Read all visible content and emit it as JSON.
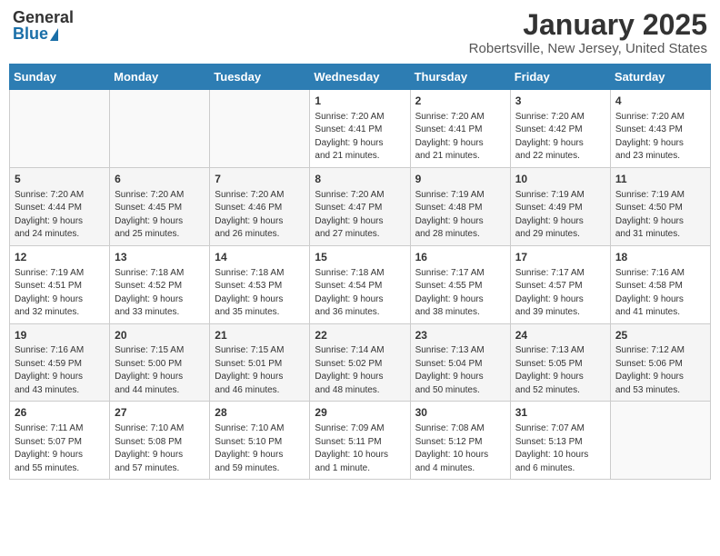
{
  "header": {
    "logo_general": "General",
    "logo_blue": "Blue",
    "title": "January 2025",
    "subtitle": "Robertsville, New Jersey, United States"
  },
  "calendar": {
    "days_of_week": [
      "Sunday",
      "Monday",
      "Tuesday",
      "Wednesday",
      "Thursday",
      "Friday",
      "Saturday"
    ],
    "weeks": [
      [
        {
          "day": "",
          "info": ""
        },
        {
          "day": "",
          "info": ""
        },
        {
          "day": "",
          "info": ""
        },
        {
          "day": "1",
          "info": "Sunrise: 7:20 AM\nSunset: 4:41 PM\nDaylight: 9 hours\nand 21 minutes."
        },
        {
          "day": "2",
          "info": "Sunrise: 7:20 AM\nSunset: 4:41 PM\nDaylight: 9 hours\nand 21 minutes."
        },
        {
          "day": "3",
          "info": "Sunrise: 7:20 AM\nSunset: 4:42 PM\nDaylight: 9 hours\nand 22 minutes."
        },
        {
          "day": "4",
          "info": "Sunrise: 7:20 AM\nSunset: 4:43 PM\nDaylight: 9 hours\nand 23 minutes."
        }
      ],
      [
        {
          "day": "5",
          "info": "Sunrise: 7:20 AM\nSunset: 4:44 PM\nDaylight: 9 hours\nand 24 minutes."
        },
        {
          "day": "6",
          "info": "Sunrise: 7:20 AM\nSunset: 4:45 PM\nDaylight: 9 hours\nand 25 minutes."
        },
        {
          "day": "7",
          "info": "Sunrise: 7:20 AM\nSunset: 4:46 PM\nDaylight: 9 hours\nand 26 minutes."
        },
        {
          "day": "8",
          "info": "Sunrise: 7:20 AM\nSunset: 4:47 PM\nDaylight: 9 hours\nand 27 minutes."
        },
        {
          "day": "9",
          "info": "Sunrise: 7:19 AM\nSunset: 4:48 PM\nDaylight: 9 hours\nand 28 minutes."
        },
        {
          "day": "10",
          "info": "Sunrise: 7:19 AM\nSunset: 4:49 PM\nDaylight: 9 hours\nand 29 minutes."
        },
        {
          "day": "11",
          "info": "Sunrise: 7:19 AM\nSunset: 4:50 PM\nDaylight: 9 hours\nand 31 minutes."
        }
      ],
      [
        {
          "day": "12",
          "info": "Sunrise: 7:19 AM\nSunset: 4:51 PM\nDaylight: 9 hours\nand 32 minutes."
        },
        {
          "day": "13",
          "info": "Sunrise: 7:18 AM\nSunset: 4:52 PM\nDaylight: 9 hours\nand 33 minutes."
        },
        {
          "day": "14",
          "info": "Sunrise: 7:18 AM\nSunset: 4:53 PM\nDaylight: 9 hours\nand 35 minutes."
        },
        {
          "day": "15",
          "info": "Sunrise: 7:18 AM\nSunset: 4:54 PM\nDaylight: 9 hours\nand 36 minutes."
        },
        {
          "day": "16",
          "info": "Sunrise: 7:17 AM\nSunset: 4:55 PM\nDaylight: 9 hours\nand 38 minutes."
        },
        {
          "day": "17",
          "info": "Sunrise: 7:17 AM\nSunset: 4:57 PM\nDaylight: 9 hours\nand 39 minutes."
        },
        {
          "day": "18",
          "info": "Sunrise: 7:16 AM\nSunset: 4:58 PM\nDaylight: 9 hours\nand 41 minutes."
        }
      ],
      [
        {
          "day": "19",
          "info": "Sunrise: 7:16 AM\nSunset: 4:59 PM\nDaylight: 9 hours\nand 43 minutes."
        },
        {
          "day": "20",
          "info": "Sunrise: 7:15 AM\nSunset: 5:00 PM\nDaylight: 9 hours\nand 44 minutes."
        },
        {
          "day": "21",
          "info": "Sunrise: 7:15 AM\nSunset: 5:01 PM\nDaylight: 9 hours\nand 46 minutes."
        },
        {
          "day": "22",
          "info": "Sunrise: 7:14 AM\nSunset: 5:02 PM\nDaylight: 9 hours\nand 48 minutes."
        },
        {
          "day": "23",
          "info": "Sunrise: 7:13 AM\nSunset: 5:04 PM\nDaylight: 9 hours\nand 50 minutes."
        },
        {
          "day": "24",
          "info": "Sunrise: 7:13 AM\nSunset: 5:05 PM\nDaylight: 9 hours\nand 52 minutes."
        },
        {
          "day": "25",
          "info": "Sunrise: 7:12 AM\nSunset: 5:06 PM\nDaylight: 9 hours\nand 53 minutes."
        }
      ],
      [
        {
          "day": "26",
          "info": "Sunrise: 7:11 AM\nSunset: 5:07 PM\nDaylight: 9 hours\nand 55 minutes."
        },
        {
          "day": "27",
          "info": "Sunrise: 7:10 AM\nSunset: 5:08 PM\nDaylight: 9 hours\nand 57 minutes."
        },
        {
          "day": "28",
          "info": "Sunrise: 7:10 AM\nSunset: 5:10 PM\nDaylight: 9 hours\nand 59 minutes."
        },
        {
          "day": "29",
          "info": "Sunrise: 7:09 AM\nSunset: 5:11 PM\nDaylight: 10 hours\nand 1 minute."
        },
        {
          "day": "30",
          "info": "Sunrise: 7:08 AM\nSunset: 5:12 PM\nDaylight: 10 hours\nand 4 minutes."
        },
        {
          "day": "31",
          "info": "Sunrise: 7:07 AM\nSunset: 5:13 PM\nDaylight: 10 hours\nand 6 minutes."
        },
        {
          "day": "",
          "info": ""
        }
      ]
    ]
  }
}
